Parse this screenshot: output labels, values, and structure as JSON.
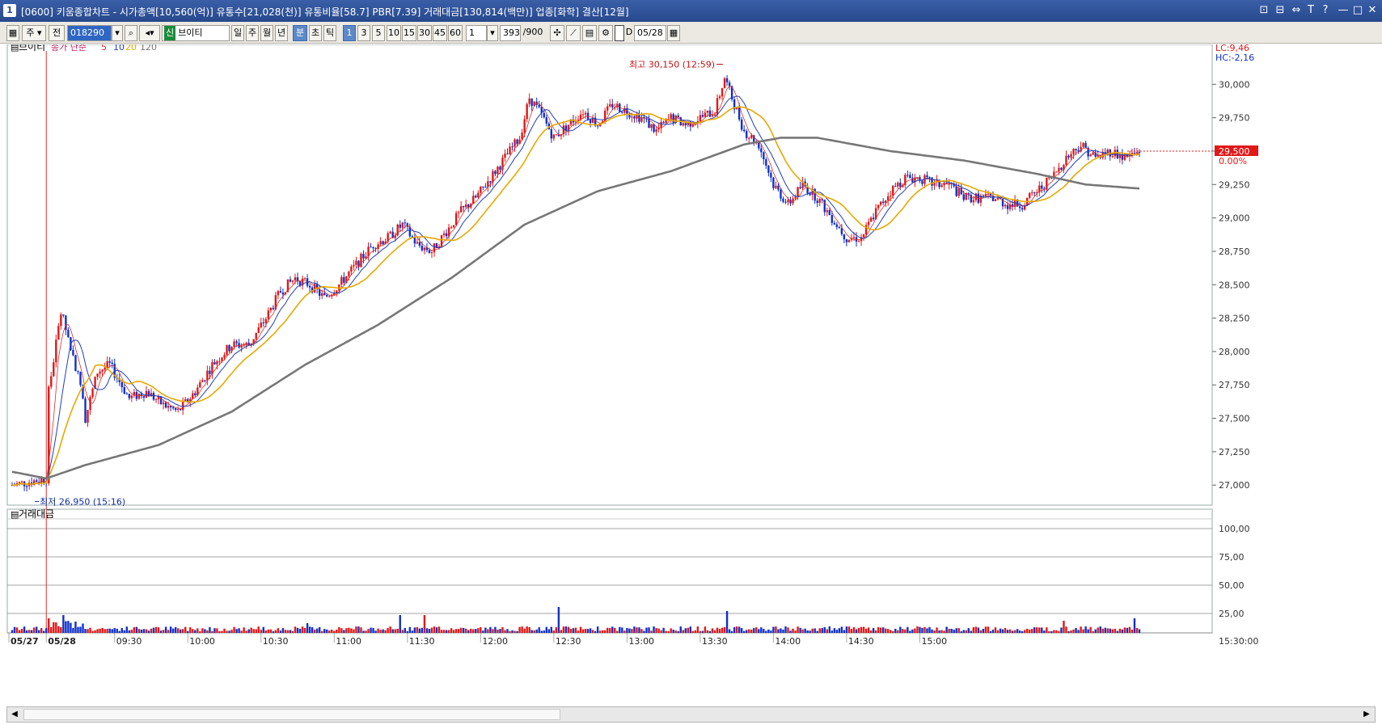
{
  "window": {
    "app_number": "1",
    "title": "[0600] 키움종합차트 - 시가총액[10,560(억)] 유통수[21,028(천)] 유통비율[58.7] PBR[7.39] 거래대금[130,814(백만)] 업종[화학] 결산[12월]",
    "buttons": [
      "⊡",
      "⊟",
      "⇔",
      "T",
      "?",
      "—",
      "□",
      "✕"
    ]
  },
  "toolbar": {
    "market": "주",
    "scope": "전",
    "code": "018290",
    "stock_badge": "신",
    "stock_name": "브이티",
    "periods": [
      "일",
      "주",
      "월",
      "년",
      "분",
      "초",
      "틱"
    ],
    "selected_period": "분",
    "intervals": [
      "1",
      "3",
      "5",
      "10",
      "15",
      "30",
      "45",
      "60"
    ],
    "selected_interval": "1",
    "multiplier": "1",
    "count": "393",
    "count_max": "/900",
    "date_flag": "D",
    "date": "05/28"
  },
  "price_panel": {
    "name": "브이티",
    "ma_label": "종가 단순",
    "ma_periods": [
      "5",
      "10",
      "20",
      "120"
    ],
    "ma_colors": [
      "#d03030",
      "#1f3fb8",
      "#e8a800",
      "#777777"
    ],
    "lc": "LC:9,46",
    "hc": "HC:-2,16",
    "current_price": "29,500",
    "current_change": "0.00%",
    "high_label": "최고 30,150 (12:59)",
    "low_label": "최저 26,950 (15:16)"
  },
  "volume_panel": {
    "name": "거래대금",
    "ticks": [
      "100,00",
      "75,00",
      "50,00",
      "25,00"
    ],
    "end_time": "15:30:00"
  },
  "chart_data": {
    "type": "candlestick",
    "x_labels": [
      "05/27",
      "05/28",
      "09:30",
      "10:00",
      "10:30",
      "11:00",
      "11:30",
      "12:00",
      "12:30",
      "13:00",
      "13:30",
      "14:00",
      "14:30",
      "15:00"
    ],
    "y_ticks": [
      "30,000",
      "29,750",
      "29,500",
      "29,250",
      "29,000",
      "28,750",
      "28,500",
      "28,250",
      "28,000",
      "27,750",
      "27,500",
      "27,250",
      "27,000"
    ],
    "ylim": [
      26850,
      30250
    ],
    "close_path": [
      [
        0,
        27000
      ],
      [
        14,
        27050
      ],
      [
        15,
        27700
      ],
      [
        20,
        28300
      ],
      [
        23,
        28100
      ],
      [
        28,
        27750
      ],
      [
        30,
        27500
      ],
      [
        35,
        27850
      ],
      [
        40,
        27900
      ],
      [
        48,
        27650
      ],
      [
        55,
        27700
      ],
      [
        62,
        27600
      ],
      [
        68,
        27550
      ],
      [
        75,
        27700
      ],
      [
        82,
        27900
      ],
      [
        90,
        28050
      ],
      [
        97,
        28050
      ],
      [
        104,
        28250
      ],
      [
        110,
        28450
      ],
      [
        116,
        28550
      ],
      [
        122,
        28500
      ],
      [
        128,
        28400
      ],
      [
        134,
        28500
      ],
      [
        141,
        28650
      ],
      [
        148,
        28800
      ],
      [
        154,
        28850
      ],
      [
        160,
        28950
      ],
      [
        166,
        28800
      ],
      [
        172,
        28750
      ],
      [
        178,
        28900
      ],
      [
        184,
        29050
      ],
      [
        190,
        29150
      ],
      [
        196,
        29300
      ],
      [
        202,
        29450
      ],
      [
        208,
        29600
      ],
      [
        212,
        29900
      ],
      [
        216,
        29800
      ],
      [
        222,
        29600
      ],
      [
        228,
        29700
      ],
      [
        234,
        29800
      ],
      [
        240,
        29700
      ],
      [
        246,
        29850
      ],
      [
        252,
        29800
      ],
      [
        258,
        29750
      ],
      [
        264,
        29650
      ],
      [
        270,
        29750
      ],
      [
        276,
        29700
      ],
      [
        282,
        29750
      ],
      [
        288,
        29800
      ],
      [
        292,
        30050
      ],
      [
        296,
        29850
      ],
      [
        300,
        29650
      ],
      [
        306,
        29550
      ],
      [
        312,
        29250
      ],
      [
        318,
        29100
      ],
      [
        324,
        29250
      ],
      [
        330,
        29150
      ],
      [
        336,
        29000
      ],
      [
        342,
        28850
      ],
      [
        348,
        28850
      ],
      [
        354,
        29050
      ],
      [
        360,
        29200
      ],
      [
        366,
        29300
      ],
      [
        372,
        29300
      ],
      [
        378,
        29250
      ],
      [
        384,
        29250
      ],
      [
        390,
        29150
      ],
      [
        396,
        29150
      ],
      [
        402,
        29150
      ],
      [
        408,
        29100
      ],
      [
        414,
        29100
      ],
      [
        420,
        29200
      ],
      [
        426,
        29300
      ],
      [
        432,
        29450
      ],
      [
        438,
        29550
      ],
      [
        444,
        29450
      ],
      [
        450,
        29500
      ],
      [
        456,
        29450
      ],
      [
        462,
        29500
      ]
    ],
    "ma120_path": [
      [
        0,
        27100
      ],
      [
        14,
        27050
      ],
      [
        30,
        27150
      ],
      [
        60,
        27300
      ],
      [
        90,
        27550
      ],
      [
        120,
        27900
      ],
      [
        150,
        28200
      ],
      [
        180,
        28550
      ],
      [
        210,
        28950
      ],
      [
        240,
        29200
      ],
      [
        270,
        29350
      ],
      [
        300,
        29550
      ],
      [
        315,
        29600
      ],
      [
        330,
        29600
      ],
      [
        360,
        29500
      ],
      [
        390,
        29430
      ],
      [
        420,
        29330
      ],
      [
        440,
        29250
      ],
      [
        462,
        29220
      ]
    ],
    "n_bars": 462,
    "volume_spikes": {
      "15": 18,
      "21": 22,
      "121": 12,
      "159": 22,
      "169": 22,
      "224": 32,
      "293": 27,
      "431": 15,
      "460": 18
    }
  }
}
